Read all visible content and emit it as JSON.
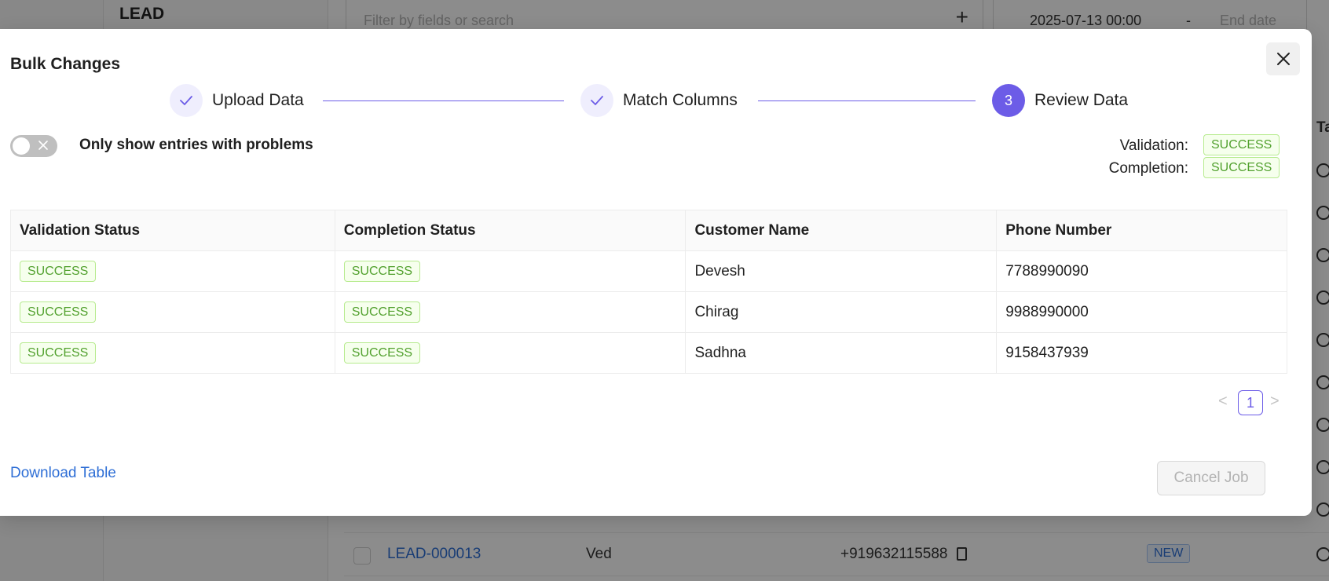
{
  "background": {
    "panel_title": "LEAD",
    "filter_placeholder": "Filter by fields or search",
    "filter_add_glyph": "+",
    "date_start": "2025-07-13 00:00",
    "date_separator": "-",
    "date_end_placeholder": "End date",
    "column_head_partial": "Ta",
    "row": {
      "lead_id": "LEAD-000013",
      "name": "Ved",
      "phone": "+919632115588",
      "status": "NEW"
    }
  },
  "modal": {
    "title": "Bulk Changes",
    "steps": [
      {
        "label": "Upload Data",
        "state": "done"
      },
      {
        "label": "Match Columns",
        "state": "done"
      },
      {
        "label": "Review Data",
        "state": "active",
        "number": "3"
      }
    ],
    "toggle_label": "Only show entries with problems",
    "summary": {
      "validation_label": "Validation:",
      "validation_value": "SUCCESS",
      "completion_label": "Completion:",
      "completion_value": "SUCCESS"
    },
    "table": {
      "headers": [
        "Validation Status",
        "Completion Status",
        "Customer Name",
        "Phone Number"
      ],
      "rows": [
        {
          "validation": "SUCCESS",
          "completion": "SUCCESS",
          "name": "Devesh",
          "phone": "7788990090"
        },
        {
          "validation": "SUCCESS",
          "completion": "SUCCESS",
          "name": "Chirag",
          "phone": "9988990000"
        },
        {
          "validation": "SUCCESS",
          "completion": "SUCCESS",
          "name": "Sadhna",
          "phone": "9158437939"
        }
      ]
    },
    "pagination": {
      "prev": "<",
      "current": "1",
      "next": ">"
    },
    "download_label": "Download Table",
    "cancel_label": "Cancel Job"
  },
  "colors": {
    "accent": "#6c5ce7",
    "success_text": "#52a12e",
    "success_bg": "#f6ffed",
    "link": "#2f6fd6"
  }
}
